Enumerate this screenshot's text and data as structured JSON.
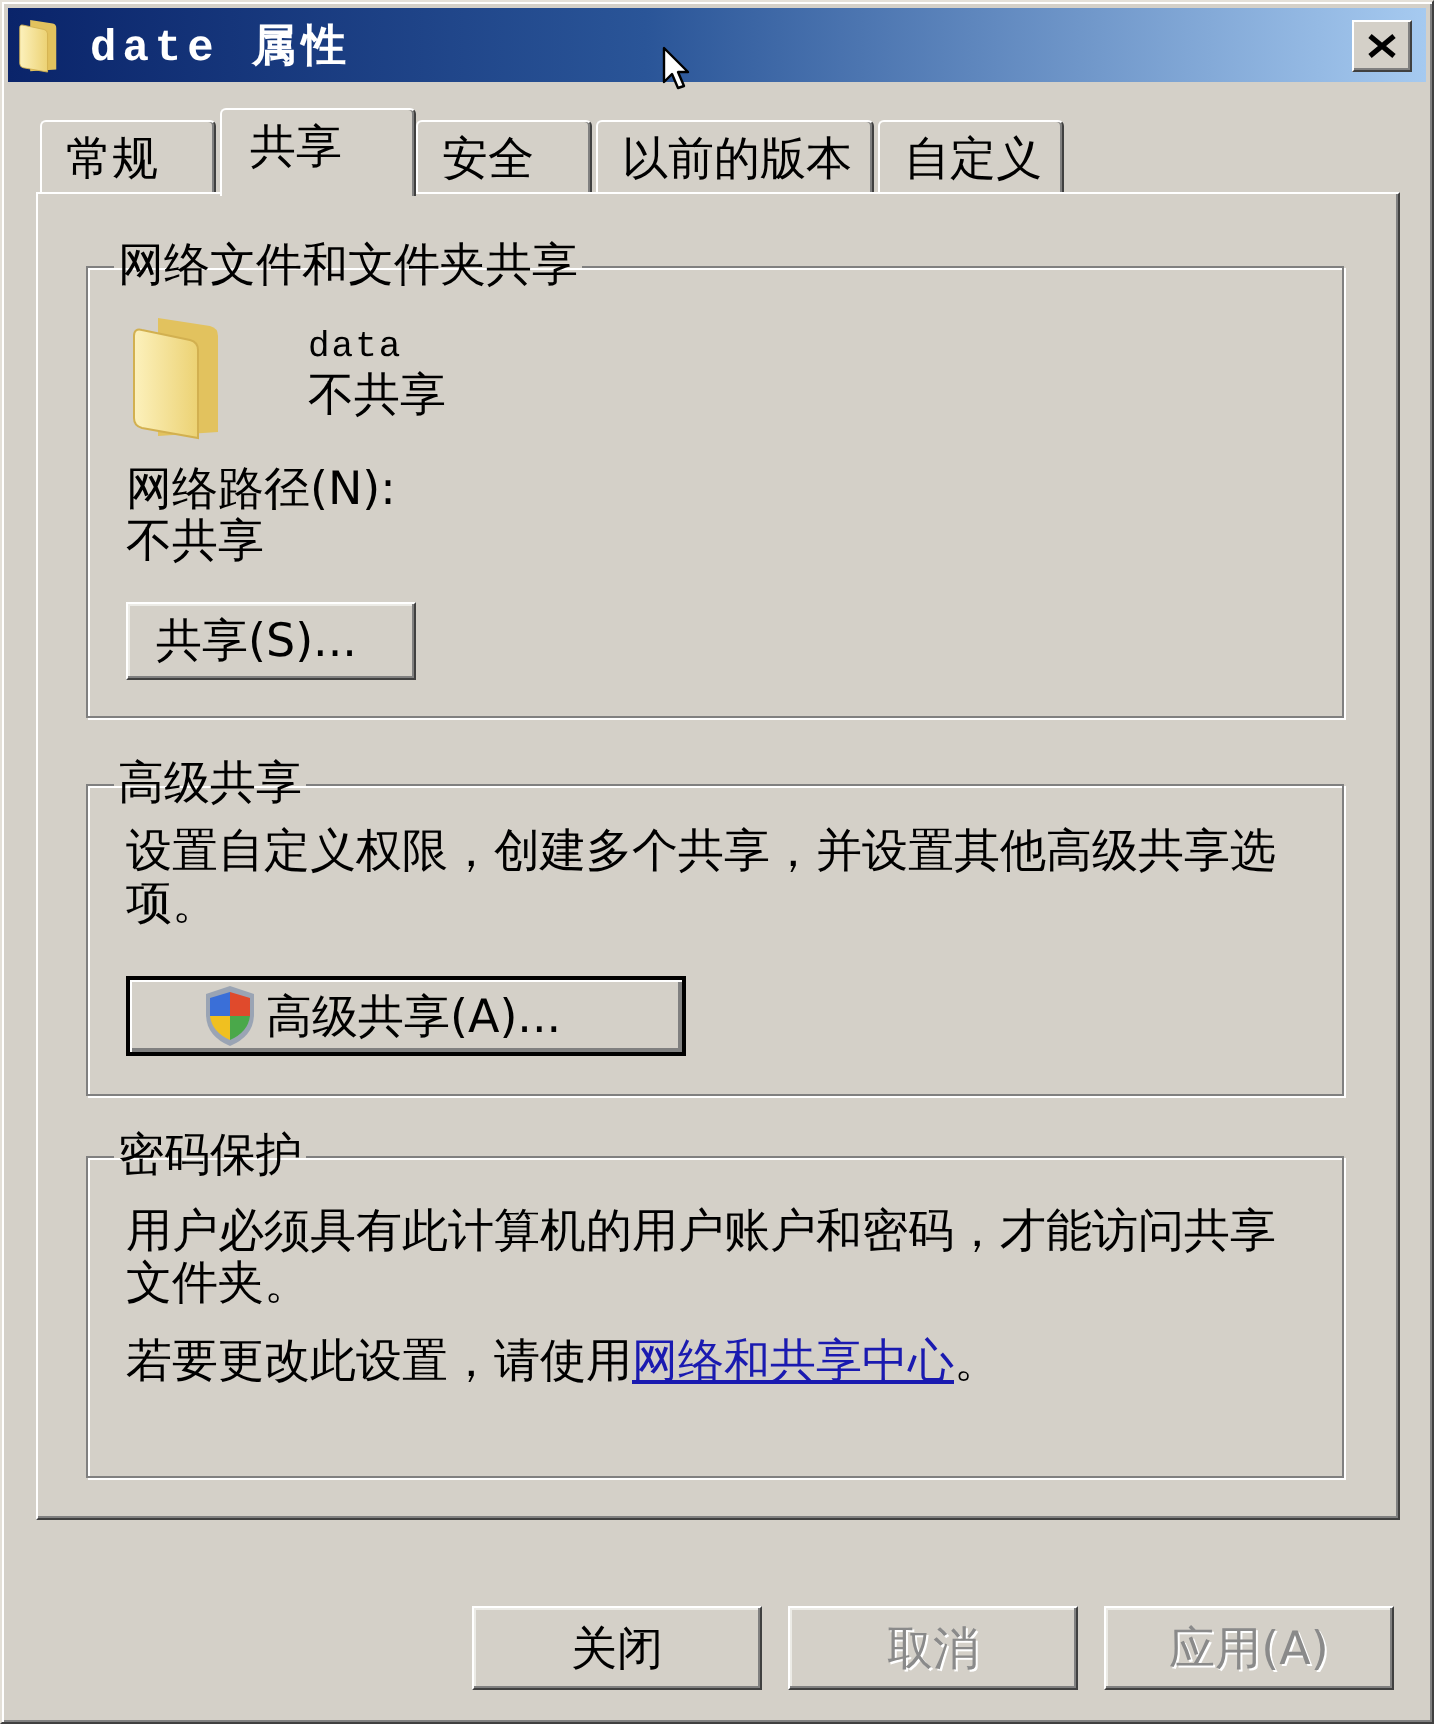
{
  "window": {
    "title": "date 属性"
  },
  "tabs": [
    {
      "label": "常规",
      "selected": false
    },
    {
      "label": "共享",
      "selected": true
    },
    {
      "label": "安全",
      "selected": false
    },
    {
      "label": "以前的版本",
      "selected": false
    },
    {
      "label": "自定义",
      "selected": false
    }
  ],
  "network_sharing": {
    "title": "网络文件和文件夹共享",
    "folder_name": "data",
    "folder_status": "不共享",
    "path_label": "网络路径(N):",
    "path_value": "不共享",
    "button": {
      "label": "共享(S)...",
      "default": false
    }
  },
  "advanced_sharing": {
    "title": "高级共享",
    "description": "设置自定义权限，创建多个共享，并设置其他高级共享选项。",
    "button": {
      "label": "高级共享(A)...",
      "default": true
    }
  },
  "password_protection": {
    "title": "密码保护",
    "description": "用户必须具有此计算机的用户账户和密码，才能访问共享文件夹。",
    "note": {
      "text": "若要更改此设置，请使用",
      "link": "网络和共享中心",
      "end": "。"
    }
  },
  "buttons": [
    {
      "label": "关闭",
      "disabled": false
    },
    {
      "label": "取消",
      "disabled": true
    },
    {
      "label": "应用(A)",
      "disabled": true
    }
  ]
}
